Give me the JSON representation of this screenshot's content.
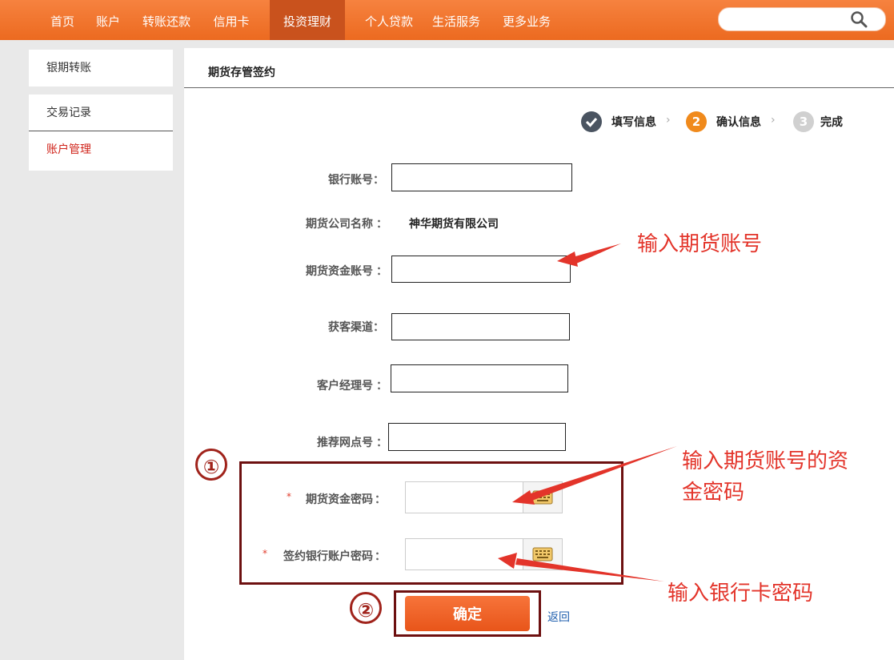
{
  "nav": {
    "items": [
      "首页",
      "账户",
      "转账还款",
      "信用卡",
      "投资理财",
      "个人贷款",
      "生活服务",
      "更多业务"
    ],
    "active_index": 4,
    "search_placeholder": ""
  },
  "sidebar": {
    "items": [
      "银期转账",
      "交易记录",
      "账户管理"
    ],
    "selected_index": 2
  },
  "page": {
    "tab_title": "期货存管签约"
  },
  "steps": [
    {
      "num": "",
      "label": "填写信息",
      "state": "done"
    },
    {
      "num": "2",
      "label": "确认信息",
      "state": "current"
    },
    {
      "num": "3",
      "label": "完成",
      "state": "pending"
    }
  ],
  "form": {
    "bank_account_label": "银行账号",
    "bank_account_value": "",
    "futures_company_label": "期货公司名称",
    "futures_company_value": "神华期货有限公司",
    "futures_fund_account_label": "期货资金账号",
    "futures_fund_account_value": "",
    "channel_label": "获客渠道",
    "channel_value": "",
    "manager_label": "客户经理号",
    "manager_value": "",
    "branch_label": "推荐网点号",
    "branch_value": "",
    "futures_password_label": "期货资金密码",
    "bank_password_label": "签约银行账户密码",
    "colon": "："
  },
  "actions": {
    "confirm_label": "确定",
    "back_label": "返回"
  },
  "annotations": {
    "futures_account_note": "输入期货账号",
    "fund_password_note_line1": "输入期货账号的资",
    "fund_password_note_line2": "金密码",
    "bank_password_note": "输入银行卡密码",
    "marker_1": "①",
    "marker_2": "②",
    "color": "#e3342a",
    "box_color": "#6d1010"
  },
  "colors": {
    "brand_orange": "#ec6a20",
    "active_nav": "#c9521d",
    "step_done": "#4a5461",
    "step_current": "#f08a1c",
    "step_pending": "#d0d0d0"
  }
}
